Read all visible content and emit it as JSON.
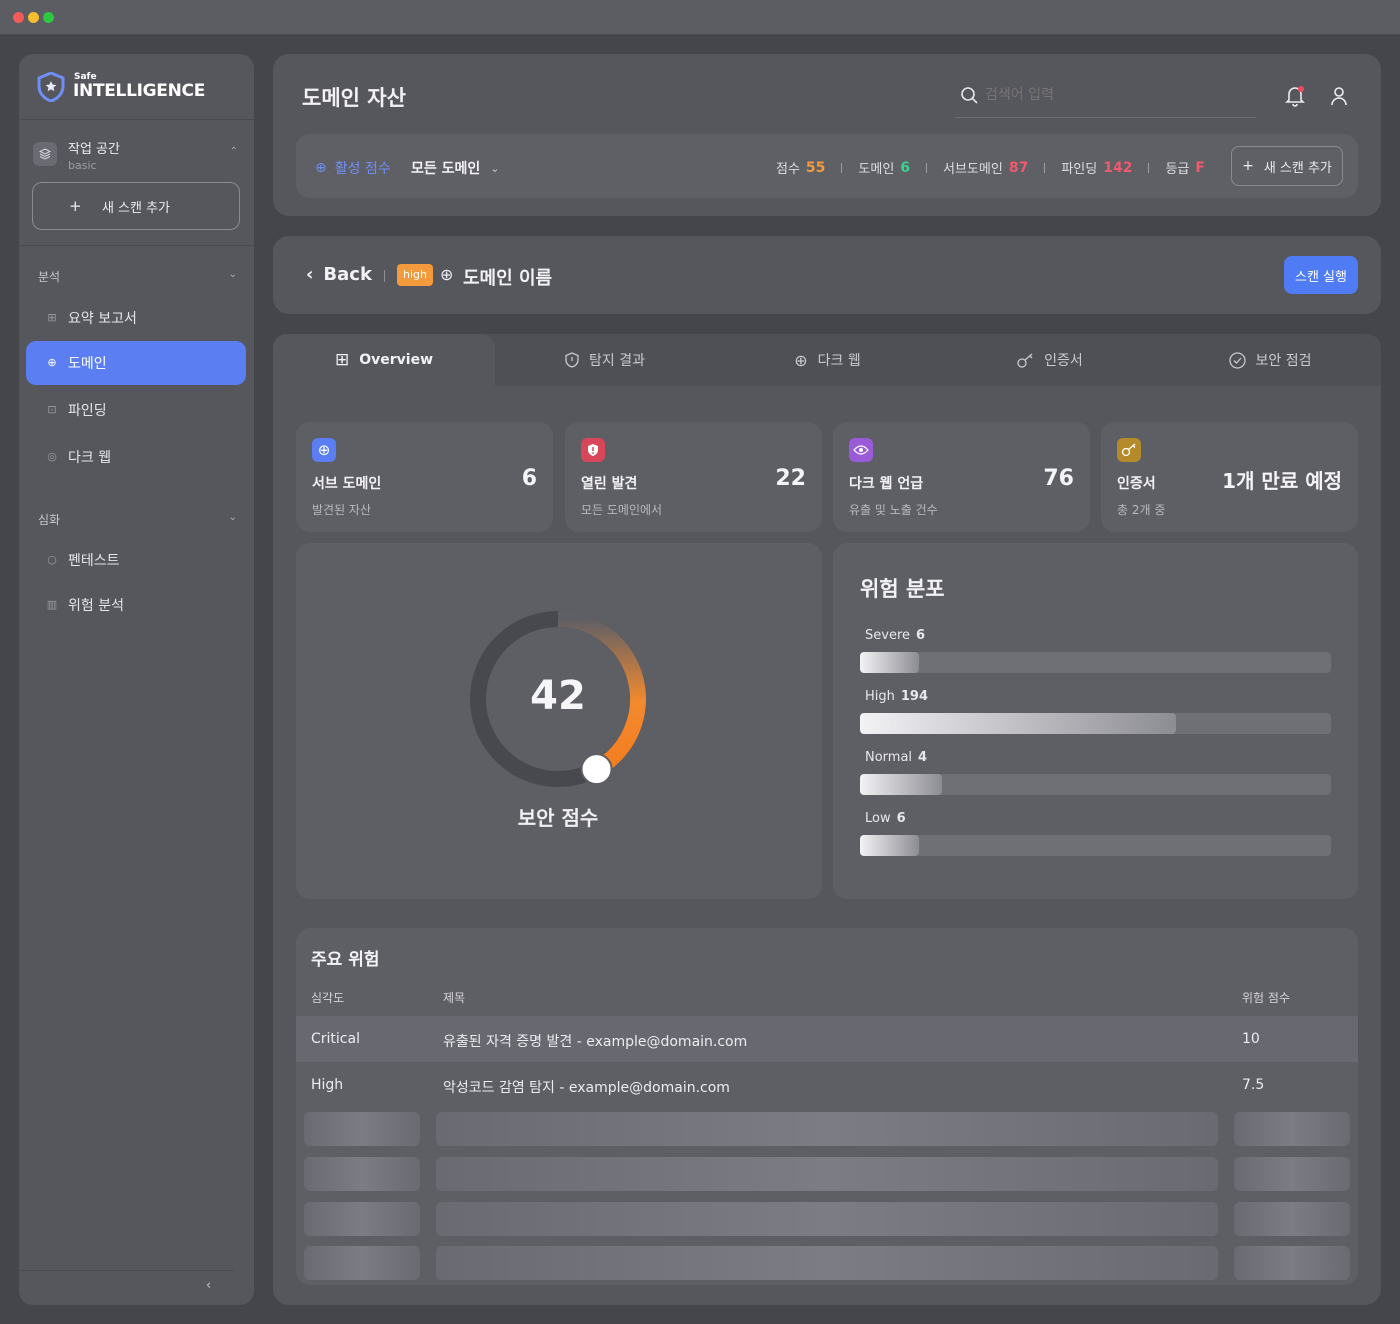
{
  "app": {
    "logo_small": "Safe",
    "logo_big": "INTELLIGENCE"
  },
  "sidebar": {
    "workspace_title": "작업 공간",
    "workspace_sub": "basic",
    "new_scan_label": "새 스캔 추가",
    "section_analysis": "분석",
    "section_advanced": "심화",
    "items": [
      {
        "label": "요약 보고서",
        "icon": "grid-icon"
      },
      {
        "label": "도메인",
        "icon": "globe-icon",
        "active": true
      },
      {
        "label": "파인딩",
        "icon": "scan-icon"
      },
      {
        "label": "다크 웹",
        "icon": "eye-icon"
      },
      {
        "label": "펜테스트",
        "icon": "circle-icon"
      },
      {
        "label": "위험 분석",
        "icon": "chart-icon"
      }
    ],
    "collapse_icon": "chevron-left-icon"
  },
  "header": {
    "title": "도메인 자산",
    "search_placeholder": "검색어 입력",
    "bell_icon": "bell-icon",
    "user_icon": "user-icon"
  },
  "filter": {
    "active_score_label": "활성 점수",
    "domain_select": "모든 도메인",
    "stats": [
      {
        "label": "점수",
        "value": "55",
        "color": "#f39a3c"
      },
      {
        "label": "도메인",
        "value": "6",
        "color": "#3fcf8e"
      },
      {
        "label": "서브도메인",
        "value": "87",
        "color": "#ef5a6c"
      },
      {
        "label": "파인딩",
        "value": "142",
        "color": "#ef5a6c"
      },
      {
        "label": "등급",
        "value": "F",
        "color": "#ef5a6c"
      }
    ],
    "new_scan_label": "새 스캔 추가"
  },
  "detail": {
    "back_label": "Back",
    "badge": "high",
    "domain_name": "도메인 이름",
    "run_scan_label": "스캔 실행"
  },
  "tabs": [
    {
      "label": "Overview",
      "icon": "grid-icon",
      "active": true
    },
    {
      "label": "탐지 결과",
      "icon": "shield-icon"
    },
    {
      "label": "다크 웹",
      "icon": "globe-icon"
    },
    {
      "label": "인증서",
      "icon": "key-icon"
    },
    {
      "label": "보안 점검",
      "icon": "check-circle-icon"
    }
  ],
  "cards": [
    {
      "title": "서브 도메인",
      "sub": "발견된 자산",
      "value": "6",
      "icon": "globe-icon",
      "icon_bg": "#5b7ff2"
    },
    {
      "title": "열린 발견",
      "sub": "모든 도메인에서",
      "value": "22",
      "icon": "shield-alert-icon",
      "icon_bg": "#d8465a"
    },
    {
      "title": "다크 웹 언급",
      "sub": "유출 및 노출 건수",
      "value": "76",
      "icon": "eye-icon",
      "icon_bg": "#9a5bd8"
    },
    {
      "title": "인증서",
      "sub": "총 2개 중",
      "value": "1개 만료 예정",
      "icon": "key-icon",
      "icon_bg": "#b58a2a"
    }
  ],
  "score": {
    "value": 42,
    "label": "보안 점수"
  },
  "risk": {
    "title": "위험 분포",
    "items": [
      {
        "label": "Severe",
        "value": "6",
        "fraction": 0.125
      },
      {
        "label": "High",
        "value": "194",
        "fraction": 0.67
      },
      {
        "label": "Normal",
        "value": "4",
        "fraction": 0.175
      },
      {
        "label": "Low",
        "value": "6",
        "fraction": 0.125
      }
    ]
  },
  "threats": {
    "title": "주요 위험",
    "columns": [
      "심각도",
      "제목",
      "위험 점수"
    ],
    "rows": [
      {
        "severity": "Critical",
        "title": "유출된 자격 증명 발견 - example@domain.com",
        "score": "10"
      },
      {
        "severity": "High",
        "title": "악성코드 감염 탐지 - example@domain.com",
        "score": "7.5"
      }
    ]
  }
}
